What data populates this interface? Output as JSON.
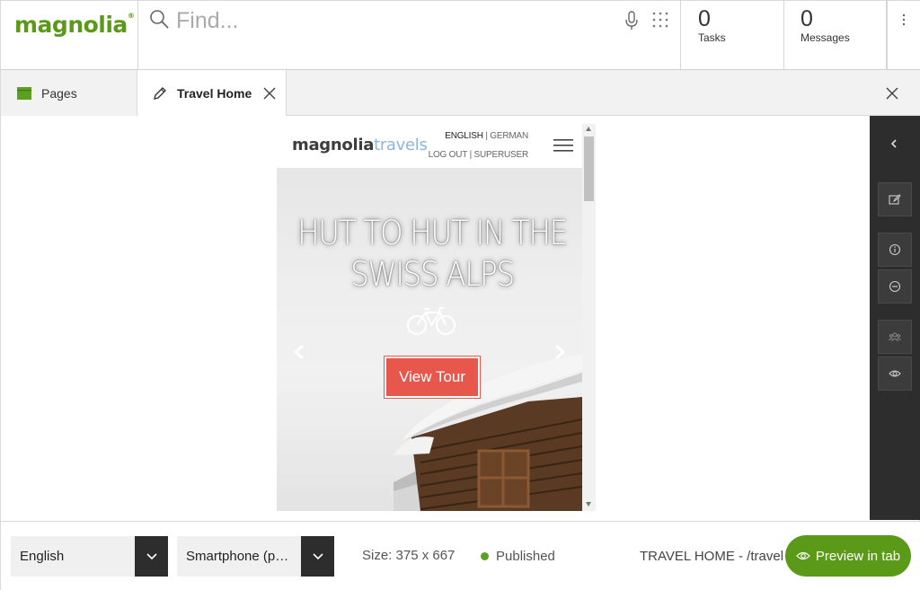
{
  "app": {
    "brand": "magnolia",
    "brand_mark": "®"
  },
  "search": {
    "placeholder": "Find..."
  },
  "counters": {
    "tasks": {
      "count": "0",
      "label": "Tasks"
    },
    "messages": {
      "count": "0",
      "label": "Messages"
    }
  },
  "tabs": [
    {
      "label": "Pages",
      "icon": "pages-app-icon",
      "active": false
    },
    {
      "label": "Travel Home",
      "icon": "pencil-icon",
      "active": true
    }
  ],
  "site": {
    "logo_main": "magnolia",
    "logo_accent": "travels",
    "lang_active": "ENGLISH",
    "lang_separator": " | ",
    "lang_other": "GERMAN",
    "login": "LOG OUT | SUPERUSER",
    "hero_title_line1": "HUT TO HUT IN THE",
    "hero_title_line2": "SWISS ALPS",
    "cta": "View Tour"
  },
  "actionbar": {
    "icons": [
      "collapse-icon",
      "edit-page-icon",
      "info-icon",
      "minus-circle-icon",
      "users-icon",
      "eye-icon"
    ]
  },
  "footer": {
    "language": "English",
    "device": "Smartphone (port...",
    "size": "Size: 375 x 667",
    "status": "Published",
    "path": "TRAVEL HOME - /travel",
    "preview_button": "Preview in tab"
  },
  "colors": {
    "brand_green": "#5a9a18",
    "status_green": "#5aa021",
    "cta_red": "#e8574c",
    "actionbar_bg": "#2d2d2d"
  }
}
